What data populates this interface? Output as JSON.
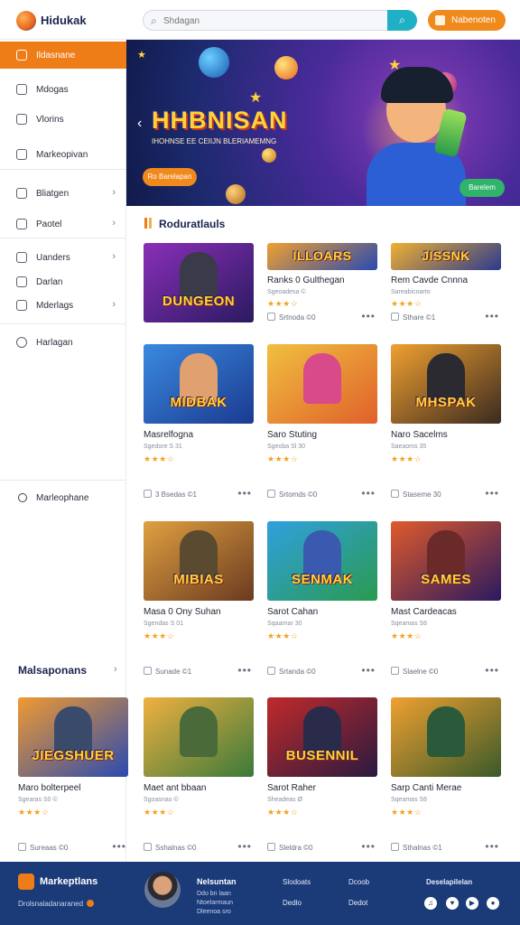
{
  "header": {
    "brand": "Hidukak",
    "search_placeholder": "Shdagan",
    "search_button": "⌕",
    "top_button": "Nabenoten"
  },
  "sidebar": {
    "items": [
      {
        "label": "Ildasnane",
        "chevron": "",
        "active": true
      },
      {
        "label": "Mdogas",
        "chevron": ""
      },
      {
        "label": "Vlorins",
        "chevron": ""
      },
      {
        "label": "Markeopivan",
        "chevron": ""
      },
      {
        "label": "Bliatgen",
        "chevron": "›"
      },
      {
        "label": "Paotel",
        "chevron": "›"
      },
      {
        "label": "Uanders",
        "chevron": "›"
      },
      {
        "label": "Darlan",
        "chevron": ""
      },
      {
        "label": "Mderlags",
        "chevron": "›"
      },
      {
        "label": "Harlagan",
        "chevron": ""
      }
    ],
    "lower_item": "Marleophane",
    "section_label": "Malsaponans",
    "section_chevron": "›"
  },
  "hero": {
    "title": "HHBNISAN",
    "subtitle": "IHOHNSE EE CEIIJN BLERIAMEMNG",
    "cta": "Ro Barelapan",
    "cta_secondary": "Barelem",
    "arrow": "‹"
  },
  "section": {
    "title": "Roduratlauls"
  },
  "cards": [
    {
      "id": "c1",
      "art": "DUNGEON",
      "title": "",
      "sub": "",
      "stars": "★★★☆",
      "meta": "",
      "more": "•••",
      "colors": [
        "#8a2fb8",
        "#2a1a60"
      ],
      "fig": "#3a3a4a"
    },
    {
      "id": "c2",
      "art": "ILLOARS",
      "title": "Ranks 0 Gulthegan",
      "sub": "Sgeoadesa ©",
      "stars": "★★★☆",
      "meta": "Srtnoda ©0",
      "more": "•••",
      "colors": [
        "#f0a030",
        "#2a4ab0"
      ],
      "fig": "#6a3a20",
      "banner": true
    },
    {
      "id": "c3",
      "art": "JISSNK",
      "title": "Rem Cavde Cnnna",
      "sub": "Sareabicoarto",
      "stars": "★★★☆",
      "meta": "Sthare ©1",
      "more": "•••",
      "colors": [
        "#f0b030",
        "#2a3a90"
      ],
      "fig": "#5a3020",
      "banner": true
    },
    {
      "id": "c4",
      "art": "MIDBAK",
      "title": "Masrelfogna",
      "sub": "Sgedore S 31",
      "stars": "★★★☆",
      "meta": "3 Bsedas ©1",
      "more": "•••",
      "colors": [
        "#3a8ae0",
        "#1a3a90"
      ],
      "fig": "#e0a070"
    },
    {
      "id": "c5",
      "art": "",
      "title": "Saro Stuting",
      "sub": "Sgeoba Sl 30",
      "stars": "★★★☆",
      "meta": "Srtomds ©0",
      "more": "•••",
      "colors": [
        "#f0c040",
        "#e0602a"
      ],
      "fig": "#d84a8a"
    },
    {
      "id": "c6",
      "art": "MHSPAK",
      "title": "Naro Sacelms",
      "sub": "Saeaoms 35",
      "stars": "★★★☆",
      "meta": "Staseme 30",
      "more": "•••",
      "colors": [
        "#f0a030",
        "#3a2a20"
      ],
      "fig": "#2a2a30"
    },
    {
      "id": "c7",
      "art": "MIBIAS",
      "title": "Masa 0 Ony Suhan",
      "sub": "Sgendas S 01",
      "stars": "★★★☆",
      "meta": "Sunade ©1",
      "more": "•••",
      "colors": [
        "#e0a040",
        "#6a3a20"
      ],
      "fig": "#5a4a30"
    },
    {
      "id": "c8",
      "art": "SENMAK",
      "title": "Sarot Cahan",
      "sub": "Sqaarnar 30",
      "stars": "★★★☆",
      "meta": "Srtanda ©0",
      "more": "•••",
      "colors": [
        "#30a0e0",
        "#2a9a50"
      ],
      "fig": "#3a5ab0"
    },
    {
      "id": "c9",
      "art": "SAMES",
      "title": "Mast Cardeacas",
      "sub": "Sqeamas S6",
      "stars": "★★★☆",
      "meta": "Slaelne ©0",
      "more": "•••",
      "colors": [
        "#e05a2a",
        "#2a1a60"
      ],
      "fig": "#6a2a2a"
    },
    {
      "id": "c10",
      "art": "JIEGSHUER",
      "title": "Maro bolterpeel",
      "sub": "Sgearas S0 ©",
      "stars": "★★★☆",
      "meta": "Sureaas ©0",
      "more": "•••",
      "colors": [
        "#f09a30",
        "#2a4ab0"
      ],
      "fig": "#3a4a6a"
    },
    {
      "id": "c11",
      "art": "",
      "title": "Maet ant bbaan",
      "sub": "Sgoasnao ©",
      "stars": "★★★☆",
      "meta": "Sshalnas ©0",
      "more": "•••",
      "colors": [
        "#f0b040",
        "#3a7a3a"
      ],
      "fig": "#4a6a3a"
    },
    {
      "id": "c12",
      "art": "BUSENNIL",
      "title": "Sarot Raher",
      "sub": "Sheadeas Ø",
      "stars": "★★★☆",
      "meta": "Sleldra ©0",
      "more": "•••",
      "colors": [
        "#c02a2a",
        "#2a1a40"
      ],
      "fig": "#2a2a4a"
    },
    {
      "id": "c13",
      "art": "",
      "title": "Sarp Canti Merae",
      "sub": "Sqeamas S6",
      "stars": "★★★☆",
      "meta": "Sthalnas ©1",
      "more": "•••",
      "colors": [
        "#f0a030",
        "#3a5a2a"
      ],
      "fig": "#2a5a3a"
    }
  ],
  "footer": {
    "brand": "Markeptlans",
    "tagline": "Drolsnaladanaraned",
    "person_name": "Nelsuntan",
    "person_lines": [
      "Ddo bn laan",
      "Ntoelarmaun",
      "Dleenoa sro"
    ],
    "links": [
      "Slodoats",
      "Dcoob",
      "Dedlo",
      "Dedot"
    ],
    "right_title": "Deselapilelan",
    "social": [
      "♫",
      "♥",
      "▶",
      "●"
    ]
  }
}
